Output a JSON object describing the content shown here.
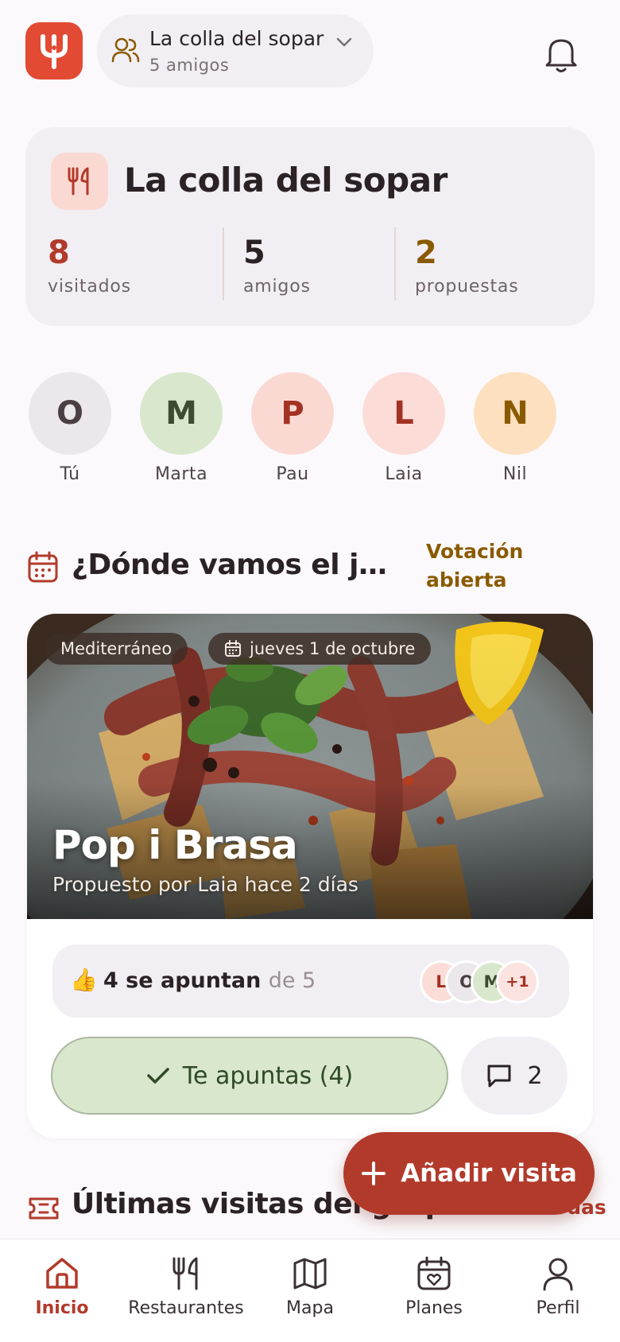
{
  "header": {
    "group_name": "La colla del sopar",
    "group_members": "5 amigos"
  },
  "summary": {
    "title": "La colla del sopar",
    "stats": [
      {
        "value": "8",
        "label": "visitados",
        "color": "#b23a2b"
      },
      {
        "value": "5",
        "label": "amigos",
        "color": "#2b2225"
      },
      {
        "value": "2",
        "label": "propuestas",
        "color": "#8a5a00"
      }
    ]
  },
  "members": [
    {
      "initial": "O",
      "name": "Tú",
      "bg": "#ebe7eb",
      "fg": "#4a3f42"
    },
    {
      "initial": "M",
      "name": "Marta",
      "bg": "#d9e7cc",
      "fg": "#3c4c30"
    },
    {
      "initial": "P",
      "name": "Pau",
      "bg": "#fbd9d3",
      "fg": "#a33224"
    },
    {
      "initial": "L",
      "name": "Laia",
      "bg": "#fcdcd7",
      "fg": "#a33224"
    },
    {
      "initial": "N",
      "name": "Nil",
      "bg": "#fde0c0",
      "fg": "#8a5a00"
    }
  ],
  "vote": {
    "title": "¿Dónde vamos el jueves?",
    "status": "Votación abierta"
  },
  "proposal": {
    "cuisine": "Mediterráneo",
    "date": "jueves 1 de octubre",
    "restaurant": "Pop i Brasa",
    "proposed_by": "Propuesto por Laia hace 2 días",
    "attending_text": "4 se apuntan",
    "attending_of": "de 5",
    "attendees": [
      {
        "initial": "L",
        "bg": "#fcdcd7",
        "fg": "#a33224"
      },
      {
        "initial": "O",
        "bg": "#ebe7eb",
        "fg": "#4a3f42"
      },
      {
        "initial": "M",
        "bg": "#d9e7cc",
        "fg": "#3c4c30"
      },
      {
        "initial": "+1",
        "bg": "#fbe3e0",
        "fg": "#a33224"
      }
    ],
    "join_label": "Te apuntas (4)",
    "comments_count": "2"
  },
  "recent": {
    "title": "Últimas visitas del grupo",
    "see_all": "Ver todas"
  },
  "fab": {
    "label": "Añadir visita"
  },
  "nav": [
    {
      "label": "Inicio",
      "icon": "home-icon",
      "active": true
    },
    {
      "label": "Restaurantes",
      "icon": "utensils-icon",
      "active": false
    },
    {
      "label": "Mapa",
      "icon": "map-icon",
      "active": false
    },
    {
      "label": "Planes",
      "icon": "calendar-heart-icon",
      "active": false
    },
    {
      "label": "Perfil",
      "icon": "user-icon",
      "active": false
    }
  ],
  "colors": {
    "brand": "#e24a33",
    "accent": "#b23a2b",
    "highlight": "#8a5a00"
  }
}
